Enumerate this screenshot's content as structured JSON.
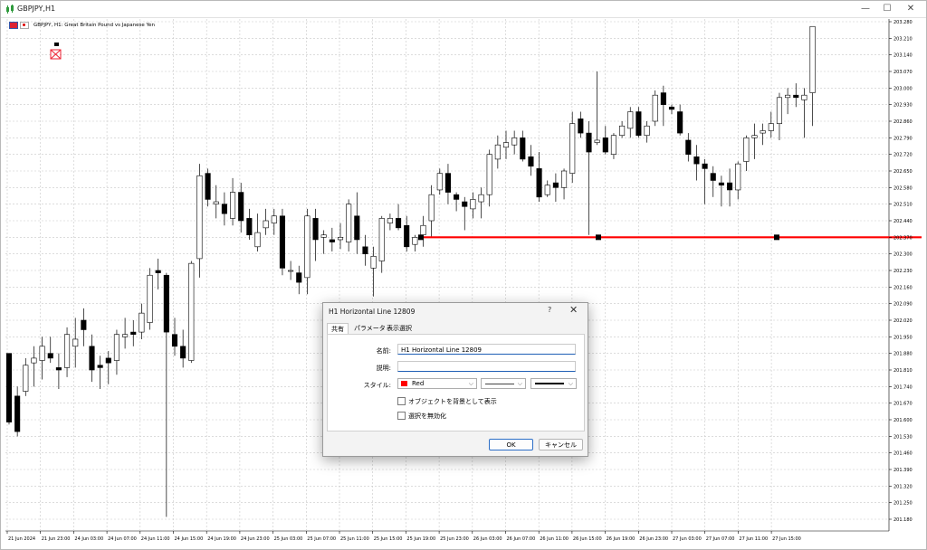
{
  "window": {
    "title": "GBPJPY,H1",
    "minimize_glyph": "—",
    "maximize_glyph": "☐",
    "close_glyph": "✕",
    "icon": "chart-app-icon"
  },
  "chart": {
    "symbol_caption": "GBPJPY, H1:  Great Britain Pound vs Japanese Yen",
    "price_labels": [
      "203.280",
      "203.210",
      "203.140",
      "203.070",
      "203.000",
      "202.930",
      "202.860",
      "202.790",
      "202.720",
      "202.650",
      "202.580",
      "202.510",
      "202.440",
      "202.370",
      "202.300",
      "202.230",
      "202.160",
      "202.090",
      "202.020",
      "201.950",
      "201.880",
      "201.810",
      "201.740",
      "201.670",
      "201.600",
      "201.530",
      "201.460",
      "201.390",
      "201.320",
      "201.250",
      "201.180"
    ],
    "time_labels": [
      "21 Jun 2024",
      "21 Jun 23:00",
      "24 Jun 03:00",
      "24 Jun 07:00",
      "24 Jun 11:00",
      "24 Jun 15:00",
      "24 Jun 19:00",
      "24 Jun 23:00",
      "25 Jun 03:00",
      "25 Jun 07:00",
      "25 Jun 11:00",
      "25 Jun 15:00",
      "25 Jun 19:00",
      "25 Jun 23:00",
      "26 Jun 03:00",
      "26 Jun 07:00",
      "26 Jun 11:00",
      "26 Jun 15:00",
      "26 Jun 19:00",
      "26 Jun 23:00",
      "27 Jun 03:00",
      "27 Jun 07:00",
      "27 Jun 11:00",
      "27 Jun 15:00"
    ],
    "colors": {
      "grid": "#c8c8c8",
      "candle": "#000000",
      "hline": "#ff0000",
      "background": "#ffffff"
    },
    "horizontal_line_price": 202.37,
    "candles": [
      [
        201.88,
        201.62,
        201.58,
        201.59
      ],
      [
        201.7,
        201.74,
        201.53,
        201.55
      ],
      [
        201.72,
        201.86,
        201.7,
        201.83
      ],
      [
        201.84,
        201.91,
        201.74,
        201.86
      ],
      [
        201.85,
        201.95,
        201.77,
        201.91
      ],
      [
        201.88,
        201.95,
        201.84,
        201.86
      ],
      [
        201.82,
        201.88,
        201.73,
        201.81
      ],
      [
        201.82,
        201.99,
        201.78,
        201.96
      ],
      [
        201.91,
        202.03,
        201.82,
        201.94
      ],
      [
        202.02,
        202.07,
        201.91,
        201.98
      ],
      [
        201.91,
        201.96,
        201.76,
        201.81
      ],
      [
        201.83,
        201.87,
        201.73,
        201.82
      ],
      [
        201.86,
        201.89,
        201.75,
        201.84
      ],
      [
        201.85,
        201.98,
        201.79,
        201.96
      ],
      [
        201.95,
        202.03,
        201.9,
        201.96
      ],
      [
        201.97,
        202.02,
        201.91,
        201.96
      ],
      [
        201.97,
        202.09,
        201.94,
        202.05
      ],
      [
        202.01,
        202.24,
        201.98,
        202.21
      ],
      [
        202.23,
        202.28,
        202.15,
        202.22
      ],
      [
        202.21,
        202.22,
        201.19,
        201.97
      ],
      [
        201.96,
        202.03,
        201.87,
        201.91
      ],
      [
        201.91,
        201.98,
        201.82,
        201.86
      ],
      [
        201.85,
        202.27,
        201.84,
        202.26
      ],
      [
        202.28,
        202.68,
        202.2,
        202.63
      ],
      [
        202.64,
        202.66,
        202.5,
        202.53
      ],
      [
        202.51,
        202.59,
        202.45,
        202.52
      ],
      [
        202.51,
        202.56,
        202.42,
        202.47
      ],
      [
        202.45,
        202.62,
        202.42,
        202.56
      ],
      [
        202.56,
        202.6,
        202.39,
        202.44
      ],
      [
        202.45,
        202.49,
        202.36,
        202.38
      ],
      [
        202.33,
        202.47,
        202.31,
        202.39
      ],
      [
        202.41,
        202.49,
        202.38,
        202.44
      ],
      [
        202.43,
        202.49,
        202.38,
        202.46
      ],
      [
        202.46,
        202.49,
        202.21,
        202.24
      ],
      [
        202.23,
        202.27,
        202.19,
        202.23
      ],
      [
        202.22,
        202.25,
        202.13,
        202.18
      ],
      [
        202.2,
        202.49,
        202.13,
        202.46
      ],
      [
        202.45,
        202.49,
        202.27,
        202.36
      ],
      [
        202.37,
        202.4,
        202.3,
        202.38
      ],
      [
        202.36,
        202.41,
        202.31,
        202.35
      ],
      [
        202.36,
        202.43,
        202.32,
        202.37
      ],
      [
        202.35,
        202.53,
        202.31,
        202.51
      ],
      [
        202.46,
        202.56,
        202.3,
        202.36
      ],
      [
        202.33,
        202.38,
        202.25,
        202.3
      ],
      [
        202.24,
        202.33,
        202.12,
        202.29
      ],
      [
        202.27,
        202.46,
        202.22,
        202.45
      ],
      [
        202.43,
        202.47,
        202.4,
        202.45
      ],
      [
        202.45,
        202.51,
        202.4,
        202.41
      ],
      [
        202.42,
        202.46,
        202.31,
        202.33
      ],
      [
        202.34,
        202.38,
        202.31,
        202.37
      ],
      [
        202.38,
        202.46,
        202.33,
        202.42
      ],
      [
        202.44,
        202.59,
        202.37,
        202.55
      ],
      [
        202.57,
        202.66,
        202.55,
        202.64
      ],
      [
        202.64,
        202.68,
        202.51,
        202.56
      ],
      [
        202.55,
        202.56,
        202.48,
        202.53
      ],
      [
        202.52,
        202.54,
        202.4,
        202.5
      ],
      [
        202.49,
        202.56,
        202.45,
        202.53
      ],
      [
        202.52,
        202.58,
        202.45,
        202.55
      ],
      [
        202.55,
        202.74,
        202.5,
        202.72
      ],
      [
        202.7,
        202.8,
        202.66,
        202.76
      ],
      [
        202.75,
        202.82,
        202.7,
        202.77
      ],
      [
        202.76,
        202.82,
        202.72,
        202.79
      ],
      [
        202.79,
        202.82,
        202.69,
        202.7
      ],
      [
        202.71,
        202.76,
        202.63,
        202.67
      ],
      [
        202.66,
        202.73,
        202.52,
        202.54
      ],
      [
        202.55,
        202.61,
        202.54,
        202.59
      ],
      [
        202.6,
        202.64,
        202.52,
        202.58
      ],
      [
        202.58,
        202.66,
        202.53,
        202.65
      ],
      [
        202.64,
        202.9,
        202.6,
        202.85
      ],
      [
        202.87,
        202.9,
        202.79,
        202.81
      ],
      [
        202.81,
        202.86,
        202.38,
        202.73
      ],
      [
        202.77,
        203.07,
        202.76,
        202.78
      ],
      [
        202.79,
        202.84,
        202.72,
        202.73
      ],
      [
        202.72,
        202.81,
        202.7,
        202.8
      ],
      [
        202.8,
        202.86,
        202.79,
        202.84
      ],
      [
        202.83,
        202.92,
        202.79,
        202.9
      ],
      [
        202.9,
        202.92,
        202.79,
        202.8
      ],
      [
        202.8,
        202.86,
        202.77,
        202.84
      ],
      [
        202.86,
        202.99,
        202.84,
        202.97
      ],
      [
        202.98,
        203.01,
        202.84,
        202.93
      ],
      [
        202.92,
        202.93,
        202.89,
        202.91
      ],
      [
        202.9,
        202.93,
        202.8,
        202.81
      ],
      [
        202.78,
        202.81,
        202.69,
        202.72
      ],
      [
        202.71,
        202.76,
        202.61,
        202.68
      ],
      [
        202.68,
        202.7,
        202.51,
        202.66
      ],
      [
        202.64,
        202.67,
        202.54,
        202.61
      ],
      [
        202.6,
        202.63,
        202.5,
        202.59
      ],
      [
        202.6,
        202.66,
        202.5,
        202.57
      ],
      [
        202.57,
        202.69,
        202.53,
        202.68
      ],
      [
        202.69,
        202.8,
        202.65,
        202.79
      ],
      [
        202.79,
        202.85,
        202.7,
        202.8
      ],
      [
        202.81,
        202.85,
        202.76,
        202.82
      ],
      [
        202.82,
        202.9,
        202.79,
        202.85
      ],
      [
        202.85,
        202.98,
        202.78,
        202.96
      ],
      [
        202.96,
        203.0,
        202.89,
        202.97
      ],
      [
        202.97,
        203.02,
        202.92,
        202.96
      ],
      [
        202.95,
        203.0,
        202.79,
        202.97
      ],
      [
        202.98,
        203.25,
        202.84,
        203.26
      ]
    ],
    "object_markers": {
      "anchor_left_price": 202.37
    }
  },
  "dialog": {
    "title": "H1 Horizontal Line 12809",
    "help_glyph": "?",
    "close_glyph": "✕",
    "tabs": [
      "共有",
      "パラメータ",
      "表示選択"
    ],
    "name_label": "名前:",
    "name_value": "H1 Horizontal Line 12809",
    "description_label": "説明:",
    "description_value": "",
    "style_label": "スタイル:",
    "color_name": "Red",
    "color_swatch": "#ff0000",
    "checkbox_background": "オブジェクトを背景として表示",
    "checkbox_disable_selection": "選択を無効化",
    "ok_label": "OK",
    "cancel_label": "キャンセル"
  }
}
